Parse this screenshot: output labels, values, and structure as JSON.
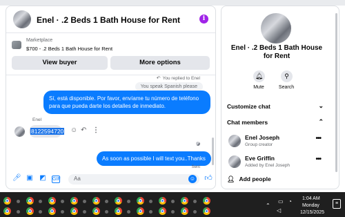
{
  "chat": {
    "title": "Enel · .2 Beds 1 Bath House for Rent",
    "info_icon": "i",
    "marketplace": {
      "label": "Marketplace",
      "listing": "$700 - .2 Beds 1 Bath House for Rent",
      "view_buyer_label": "View buyer",
      "more_options_label": "More options"
    },
    "messages": {
      "replied_label": "You replied to Enel",
      "quoted_text": "You speak Spanish please",
      "outgoing_1": "Sí, está disponible. Por favor, envíame tu número de teléfono para que pueda darte los detalles de inmediato.",
      "sender_name": "Enel",
      "incoming_selected": "8122594720",
      "outgoing_2": "As soon as possible I will text you..Thanks",
      "status": "Sent"
    },
    "composer": {
      "placeholder": "Aa"
    }
  },
  "side": {
    "title": "Enel · .2 Beds 1 Bath House for Rent",
    "mute_label": "Mute",
    "search_label": "Search",
    "customize_label": "Customize chat",
    "members_label": "Chat members",
    "members": [
      {
        "name": "Enel Joseph",
        "role": "Group creator"
      },
      {
        "name": "Eve Griffin",
        "role": "Added by Enel Joseph"
      }
    ],
    "add_people_label": "Add people"
  },
  "taskbar": {
    "time": "1:04 AM",
    "day": "Monday",
    "date": "12/15/2025"
  },
  "colors": {
    "accent": "#0a7cff",
    "info": "#a024e8",
    "taskbar": "#1f1f1f"
  }
}
